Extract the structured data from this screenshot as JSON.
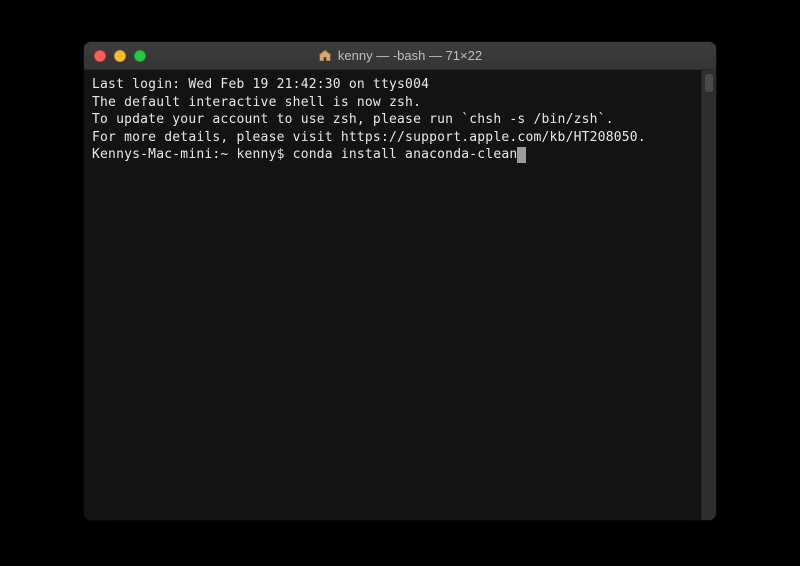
{
  "window": {
    "title": "kenny — -bash — 71×22",
    "icon": "home-icon"
  },
  "colors": {
    "bg": "#131313",
    "fg": "#e8e8e8",
    "titlebar": "#3a3a3a",
    "traffic_red": "#ff5f56",
    "traffic_yellow": "#ffbd2e",
    "traffic_green": "#27c93f"
  },
  "terminal": {
    "lines": [
      "Last login: Wed Feb 19 21:42:30 on ttys004",
      "",
      "The default interactive shell is now zsh.",
      "To update your account to use zsh, please run `chsh -s /bin/zsh`.",
      "For more details, please visit https://support.apple.com/kb/HT208050."
    ],
    "prompt": "Kennys-Mac-mini:~ kenny$ ",
    "command": "conda install anaconda-clean"
  }
}
